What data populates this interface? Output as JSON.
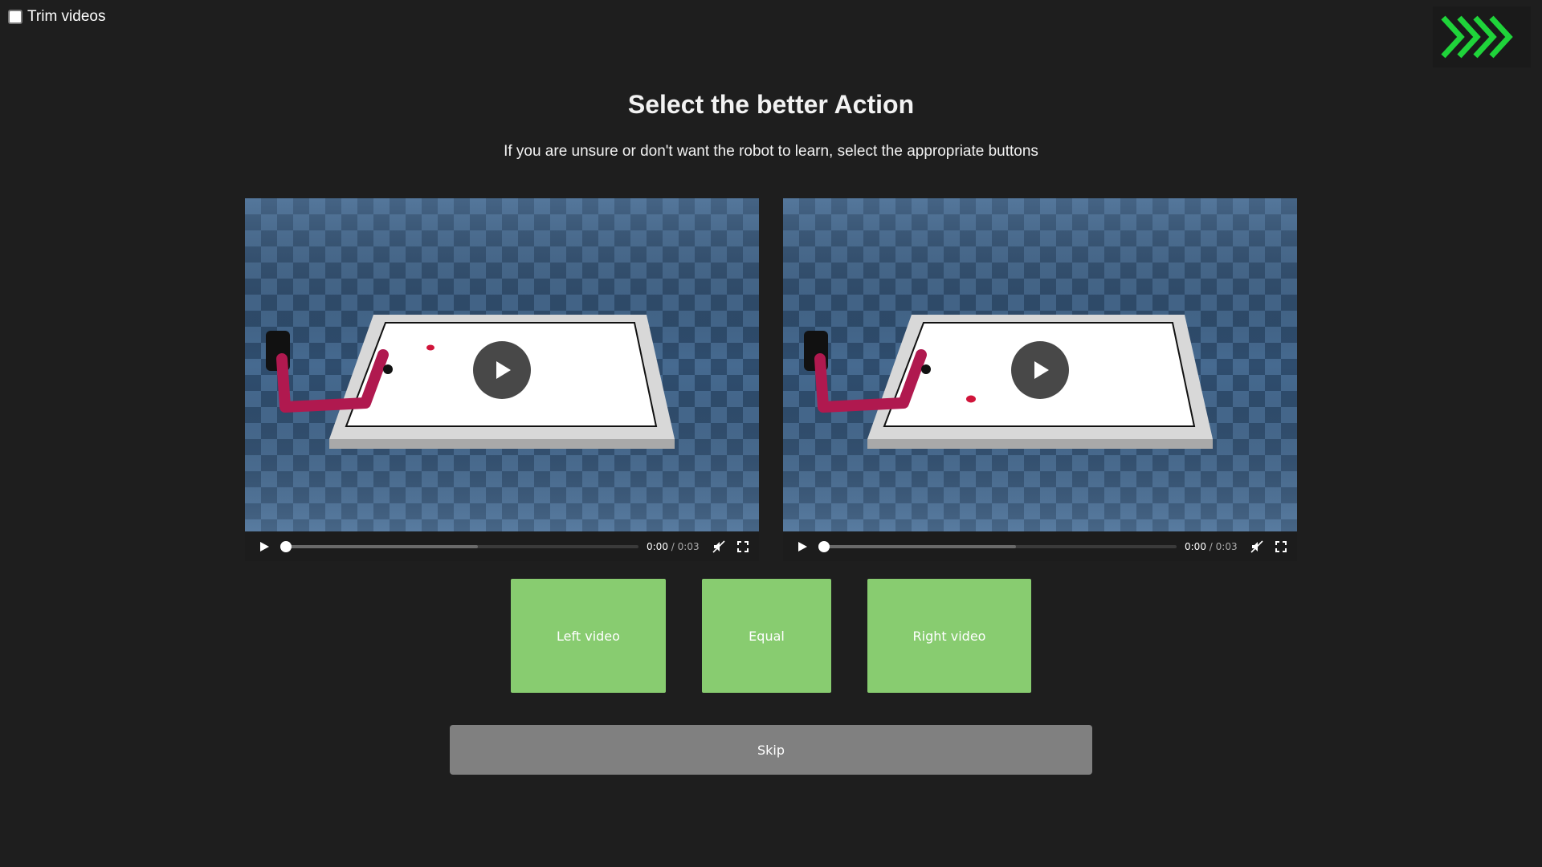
{
  "trim": {
    "label": "Trim videos",
    "checked": false
  },
  "logo": {
    "icon": "chevrons-right-icon",
    "color": "#1fd43a"
  },
  "page": {
    "title": "Select the better Action",
    "subtitle": "If you are unsure or don't want the robot to learn, select the appropriate buttons"
  },
  "videos": [
    {
      "position": "left",
      "current_time": "0:00",
      "duration": "/ 0:03",
      "progress": 0.0,
      "muted": true
    },
    {
      "position": "right",
      "current_time": "0:00",
      "duration": "/ 0:03",
      "progress": 0.0,
      "muted": true
    }
  ],
  "buttons": {
    "left_video": "Left video",
    "equal": "Equal",
    "right_video": "Right video",
    "skip": "Skip"
  },
  "colors": {
    "background": "#1e1e1e",
    "choice_button": "#88cc70",
    "skip_button": "#808080"
  }
}
